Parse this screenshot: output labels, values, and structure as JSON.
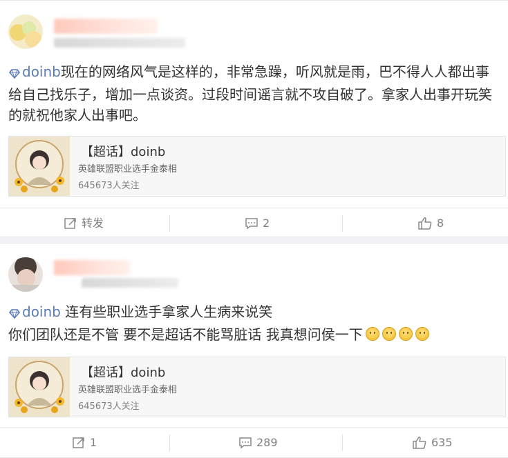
{
  "posts": [
    {
      "text_mention": "doinb",
      "text_body": "现在的网络风气是这样的，非常急躁，听风就是雨，巴不得人人都出事给自己找乐子，增加一点谈资。过段时间谣言就不攻自破了。拿家人出事开玩笑的就祝他家人出事吧。",
      "card": {
        "title": "【超话】doinb",
        "subtitle": "英雄联盟职业选手金泰相",
        "followers": "645673人关注"
      },
      "actions": {
        "repost": "转发",
        "comments": "2",
        "likes": "8"
      }
    },
    {
      "text_mention": "doinb",
      "text_line1": " 连有些职业选手拿家人生病来说笑",
      "text_line2": "你们团队还是不管 要不是超话不能骂脏话 我真想问侯一下",
      "card": {
        "title": "【超话】doinb",
        "subtitle": "英雄联盟职业选手金泰相",
        "followers": "645673人关注"
      },
      "actions": {
        "repost": "1",
        "comments": "289",
        "likes": "635"
      }
    }
  ],
  "icons": {
    "super_topic": "diamond-icon",
    "repost": "repost-icon",
    "comment": "comment-icon",
    "like": "thumbs-up-icon",
    "emoji": "smile-emoji-icon"
  },
  "colors": {
    "mention": "#5b7db8",
    "text": "#333333",
    "muted": "#808080",
    "background": "#f2f2f5"
  }
}
